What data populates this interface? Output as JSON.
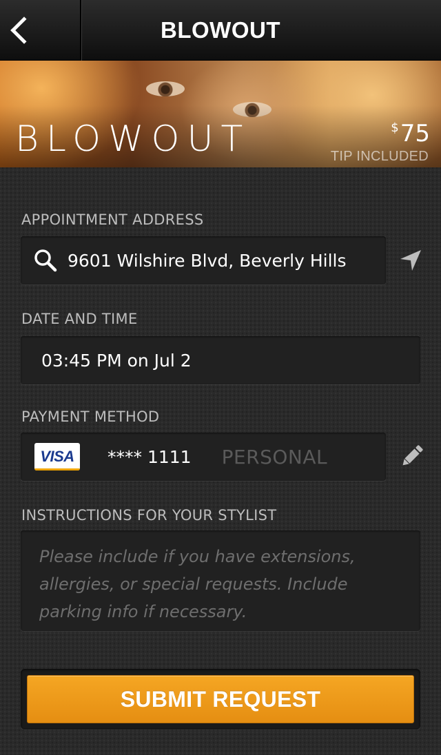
{
  "navbar": {
    "back_icon": "chevron-left-icon",
    "title": "BLOWOUT"
  },
  "hero": {
    "title": "BLOWOUT",
    "price_currency": "$",
    "price_amount": "75",
    "price_note": "TIP INCLUDED"
  },
  "address": {
    "label": "APPOINTMENT ADDRESS",
    "value": "9601 Wilshire Blvd, Beverly Hills",
    "left_icon": "search-icon",
    "right_icon": "location-arrow-icon"
  },
  "datetime": {
    "label": "DATE AND TIME",
    "value": "03:45 PM on Jul 2"
  },
  "payment": {
    "label": "PAYMENT METHOD",
    "card_brand": "VISA",
    "card_number": "**** 1111",
    "card_type": "PERSONAL",
    "edit_icon": "pencil-icon"
  },
  "instructions": {
    "label": "INSTRUCTIONS FOR YOUR STYLIST",
    "placeholder": "Please include if you have extensions, allergies, or special requests. Include parking info if necessary."
  },
  "submit": {
    "label": "SUBMIT REQUEST"
  },
  "colors": {
    "accent": "#f0a01c",
    "background": "#2a2a2a",
    "field": "#212121"
  }
}
